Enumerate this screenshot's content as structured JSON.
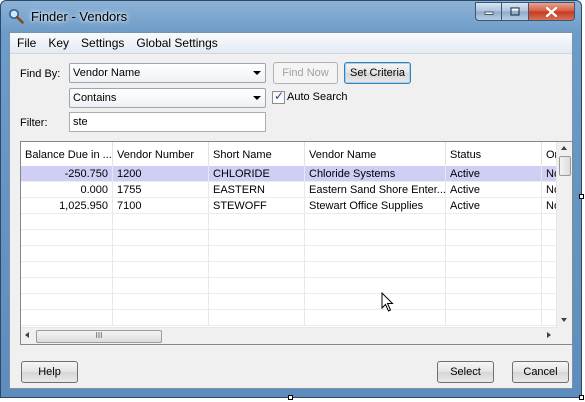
{
  "window": {
    "title": "Finder - Vendors"
  },
  "menu": [
    "File",
    "Key",
    "Settings",
    "Global Settings"
  ],
  "find_by": {
    "label": "Find By:",
    "field": "Vendor Name",
    "operator": "Contains",
    "find_now_label": "Find Now",
    "set_criteria_label": "Set Criteria",
    "auto_search_label": "Auto Search",
    "auto_search_checked": true
  },
  "filter": {
    "label": "Filter:",
    "value": "ste"
  },
  "grid": {
    "columns": [
      "Balance Due in ...",
      "Vendor Number",
      "Short Name",
      "Vendor Name",
      "Status",
      "On"
    ],
    "rows": [
      {
        "balance": "-250.750",
        "vendor_number": "1200",
        "short_name": "CHLORIDE",
        "vendor_name": "Chloride Systems",
        "status": "Active",
        "on": "No"
      },
      {
        "balance": "0.000",
        "vendor_number": "1755",
        "short_name": "EASTERN",
        "vendor_name": "Eastern Sand Shore Enter...",
        "status": "Active",
        "on": "No"
      },
      {
        "balance": "1,025.950",
        "vendor_number": "7100",
        "short_name": "STEWOFF",
        "vendor_name": "Stewart Office Supplies",
        "status": "Active",
        "on": "No"
      }
    ],
    "selected_row": 0,
    "hscroll_thumb_label": "III"
  },
  "buttons": {
    "help": "Help",
    "select": "Select",
    "cancel": "Cancel"
  },
  "colors": {
    "selected_row": "#cfcff5",
    "title_bar": "#6e9cc8",
    "close_button": "#c33a1f"
  },
  "icons": {
    "app": "magnifier-icon",
    "minimize": "minimize-icon",
    "maximize": "maximize-icon",
    "close": "close-icon"
  }
}
